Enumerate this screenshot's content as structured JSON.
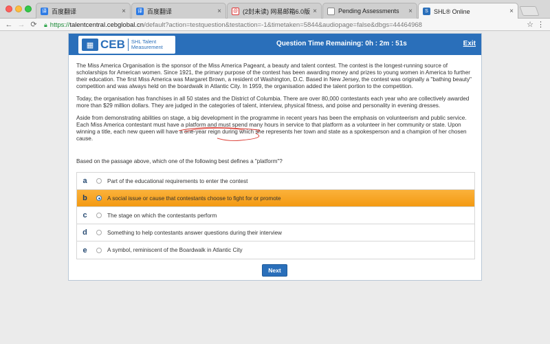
{
  "browser": {
    "tabs": [
      {
        "title": "百度翻译",
        "icon": "baidu-translate-icon"
      },
      {
        "title": "百度翻译",
        "icon": "baidu-translate-icon"
      },
      {
        "title": "(2封未读) 网易邮箱6.0版",
        "icon": "netease-mail-icon"
      },
      {
        "title": "Pending Assessments",
        "icon": "document-icon"
      },
      {
        "title": "SHL® Online",
        "icon": "shl-icon"
      }
    ],
    "active_tab": 4,
    "close_glyph": "×",
    "url_scheme": "https://",
    "url_host": "talentcentral.cebglobal.cn",
    "url_rest": "/default?action=testquestion&testaction=-1&timetaken=5844&audiopage=false&dbgs=44464968"
  },
  "header": {
    "logo_text": "CEB",
    "logo_sub1": "SHL Talent",
    "logo_sub2": "Measurement",
    "timer": "Question Time Remaining: 0h : 2m : 51s",
    "exit": "Exit"
  },
  "passage": [
    "The Miss America Organisation is the sponsor of the Miss America Pageant, a beauty and talent contest. The contest is the longest-running source of scholarships for American women. Since 1921, the primary purpose of the contest has been awarding money and prizes to young women in America to further their education. The first Miss America was Margaret Brown, a resident of Washington, D.C. Based in New Jersey, the contest was originally a \"bathing beauty\" competition and was always held on the boardwalk in Atlantic City. In 1959, the organisation added the talent portion to the competition.",
    "Today, the organisation has franchises in all 50 states and the District of Columbia. There are over 80,000 contestants each year who are collectively awarded more than $29 million dollars. They are judged in the categories of talent, interview, physical fitness, and poise and personality in evening dresses.",
    "Aside from demonstrating abilities on stage, a big development in the programme in recent years has been the emphasis on volunteerism and public service. Each Miss America contestant must have a platform and must spend many hours in service to that platform as a volunteer in her community or state. Upon winning a title, each new queen will have a one-year reign during which she represents her town and state as a spokesperson and a champion of her chosen cause."
  ],
  "question": "Based on the passage above, which one of the following best defines a \"platform\"?",
  "options": [
    {
      "letter": "a",
      "text": "Part of the educational requirements to enter the contest"
    },
    {
      "letter": "b",
      "text": "A social issue or cause that contestants choose to fight for or promote"
    },
    {
      "letter": "c",
      "text": "The stage on which the contestants perform"
    },
    {
      "letter": "d",
      "text": "Something to help contestants answer questions during their interview"
    },
    {
      "letter": "e",
      "text": "A symbol, reminiscent of the Boardwalk in Atlantic City"
    }
  ],
  "selected_option": "b",
  "next_button": "Next",
  "colors": {
    "header_blue": "#2a6fba",
    "selected_orange": "#f7a523",
    "annotation_red": "#d9342b"
  }
}
